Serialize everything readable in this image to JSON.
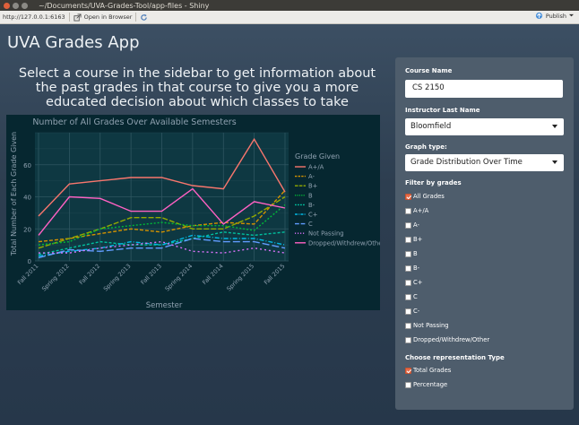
{
  "window": {
    "title": "~/Documents/UVA-Grades-Tool/app-files - Shiny"
  },
  "toolbar": {
    "url": "http://127.0.0.1:6163",
    "open_browser": "Open in Browser",
    "publish": "Publish"
  },
  "app": {
    "title": "UVA Grades App",
    "headline": "Select a course in the sidebar to get information about the past grades in that course to give you a more educated decision about which classes to take"
  },
  "sidebar": {
    "course_label": "Course Name",
    "course_value": "CS 2150",
    "instructor_label": "Instructor Last Name",
    "instructor_value": "Bloomfield",
    "graph_label": "Graph type:",
    "graph_value": "Grade Distribution Over Time",
    "filter_label": "Filter by grades",
    "filters": [
      {
        "label": "All Grades",
        "checked": true
      },
      {
        "label": "A+/A",
        "checked": false
      },
      {
        "label": "A-",
        "checked": false
      },
      {
        "label": "B+",
        "checked": false
      },
      {
        "label": "B",
        "checked": false
      },
      {
        "label": "B-",
        "checked": false
      },
      {
        "label": "C+",
        "checked": false
      },
      {
        "label": "C",
        "checked": false
      },
      {
        "label": "C-",
        "checked": false
      },
      {
        "label": "Not Passing",
        "checked": false
      },
      {
        "label": "Dropped/Withdrew/Other",
        "checked": false
      }
    ],
    "rep_label": "Choose representation Type",
    "reps": [
      {
        "label": "Total Grades",
        "checked": true
      },
      {
        "label": "Percentage",
        "checked": false
      }
    ]
  },
  "chart_data": {
    "type": "line",
    "title": "Number of All Grades Over Available Semesters",
    "xlabel": "Semester",
    "ylabel": "Total Number of Each Grade Given",
    "categories": [
      "Fall 2011",
      "Spring 2012",
      "Fall 2012",
      "Spring 2013",
      "Fall 2013",
      "Spring 2014",
      "Fall 2014",
      "Spring 2015",
      "Fall 2015"
    ],
    "ylim": [
      0,
      80
    ],
    "yticks": [
      0,
      20,
      40,
      60
    ],
    "legend_title": "Grade Given",
    "legend_position": "right",
    "grid": true,
    "series": [
      {
        "name": "A+/A",
        "color": "#f8766d",
        "dash": "solid",
        "values": [
          28,
          48,
          50,
          52,
          52,
          47,
          45,
          76,
          43
        ]
      },
      {
        "name": "A-",
        "color": "#d39200",
        "dash": "4,2",
        "values": [
          12,
          14,
          17,
          20,
          18,
          22,
          24,
          23,
          44
        ]
      },
      {
        "name": "B+",
        "color": "#93aa00",
        "dash": "6,2",
        "values": [
          8,
          14,
          20,
          27,
          27,
          20,
          20,
          28,
          40
        ]
      },
      {
        "name": "B",
        "color": "#00ba38",
        "dash": "2,2",
        "values": [
          10,
          12,
          20,
          22,
          24,
          22,
          22,
          19,
          35
        ]
      },
      {
        "name": "B-",
        "color": "#00c19f",
        "dash": "3,2",
        "values": [
          4,
          8,
          12,
          10,
          10,
          14,
          18,
          16,
          18
        ]
      },
      {
        "name": "C+",
        "color": "#00b9e3",
        "dash": "5,2,1,2",
        "values": [
          3,
          6,
          8,
          12,
          10,
          16,
          14,
          14,
          10
        ]
      },
      {
        "name": "C",
        "color": "#619cff",
        "dash": "8,3",
        "values": [
          2,
          7,
          6,
          8,
          8,
          14,
          12,
          12,
          8
        ]
      },
      {
        "name": "Not Passing",
        "color": "#db72fb",
        "dash": "2,3",
        "values": [
          5,
          5,
          8,
          10,
          12,
          6,
          5,
          8,
          5
        ]
      },
      {
        "name": "Dropped/Withdrew/Other",
        "color": "#ff61c3",
        "dash": "solid",
        "values": [
          16,
          40,
          39,
          31,
          31,
          45,
          23,
          37,
          33
        ]
      }
    ]
  }
}
